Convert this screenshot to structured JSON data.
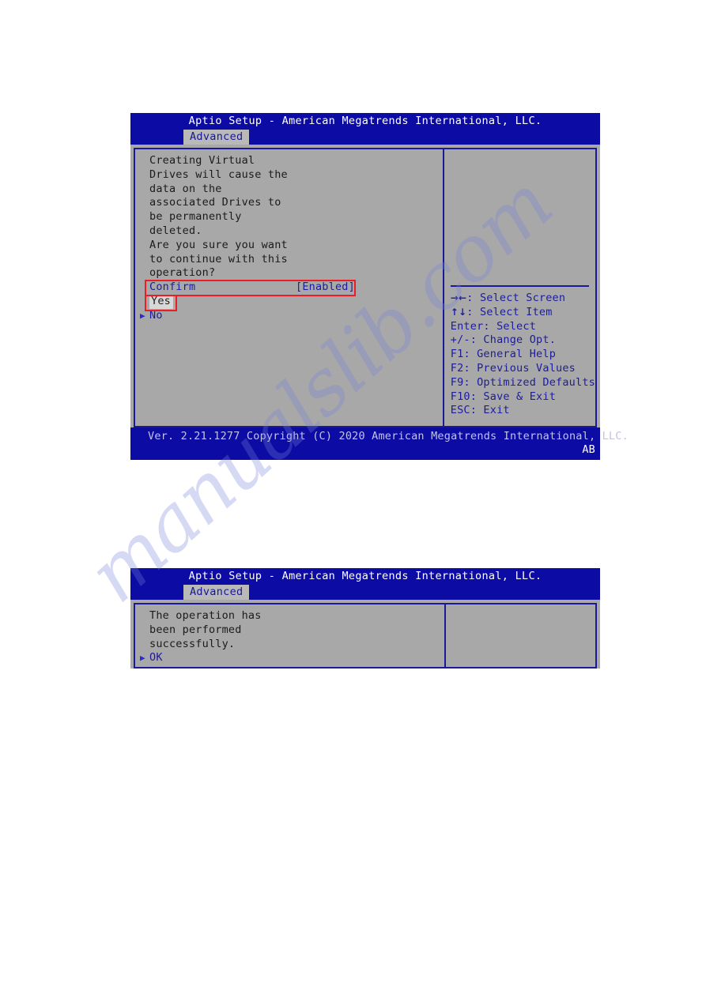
{
  "watermark": {
    "text": "manualslib.com"
  },
  "screens": [
    {
      "id": "confirm-dialog",
      "title": "Aptio Setup - American Megatrends International, LLC.",
      "tab": "Advanced",
      "message_lines": [
        "Creating Virtual",
        "Drives will cause the",
        "data on the",
        "associated Drives to",
        "be permanently",
        "deleted.",
        "Are you sure you want",
        "to continue with this",
        "operation?"
      ],
      "option": {
        "label": "Confirm",
        "value": "[Enabled]"
      },
      "choices": [
        {
          "label": "Yes",
          "selected": true,
          "bullet": ""
        },
        {
          "label": "No",
          "selected": false,
          "bullet": "▶"
        }
      ],
      "help_keys": [
        {
          "keys": "→←",
          "action": ": Select Screen"
        },
        {
          "keys": "↑↓",
          "action": ": Select Item"
        },
        {
          "keys": "Enter",
          "action": ": Select"
        },
        {
          "keys": "+/-",
          "action": ": Change Opt."
        },
        {
          "keys": "F1",
          "action": ": General Help"
        },
        {
          "keys": "F2",
          "action": ": Previous Values"
        },
        {
          "keys": "F9",
          "action": ": Optimized Defaults"
        },
        {
          "keys": "F10",
          "action": ": Save & Exit"
        },
        {
          "keys": "ESC",
          "action": ": Exit"
        }
      ],
      "footer": {
        "version": "Ver. 2.21.1277 Copyright (C) 2020 American Megatrends International, LLC.",
        "code": "AB"
      }
    },
    {
      "id": "success-dialog",
      "title": "Aptio Setup - American Megatrends International, LLC.",
      "tab": "Advanced",
      "message_lines": [
        "The operation has",
        "been performed",
        "successfully."
      ],
      "choices": [
        {
          "label": "OK",
          "selected": false,
          "bullet": "▶"
        }
      ]
    }
  ],
  "annotations": {
    "confirm_highlight": "Confirm [Enabled] row highlighted",
    "yes_highlight": "Yes choice highlighted",
    "color": "#ee1c25"
  }
}
